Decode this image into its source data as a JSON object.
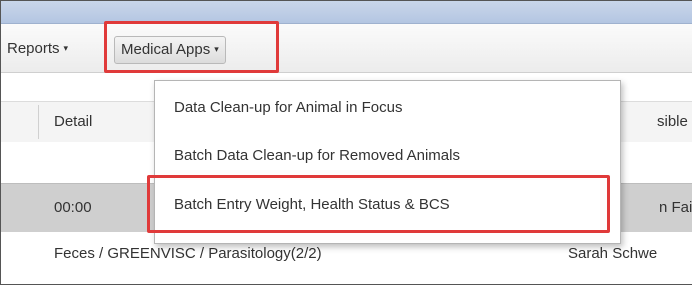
{
  "menubar": {
    "reports_label": "Reports",
    "medical_apps_label": "Medical Apps",
    "caret": "▾"
  },
  "grid": {
    "header_detail": "Detail",
    "header_responsible": "sible",
    "rows": [
      {
        "detail": "00:00",
        "responsible": "n Fai"
      },
      {
        "detail": "Feces / GREENVISC / Parasitology(2/2)",
        "responsible": "Sarah Schwe"
      }
    ]
  },
  "dropdown": {
    "items": [
      {
        "label": "Data Clean-up for Animal in Focus"
      },
      {
        "label": "Batch Data Clean-up for Removed Animals"
      },
      {
        "label": "Batch Entry Weight, Health Status & BCS"
      }
    ]
  },
  "colors": {
    "highlight": "#e03a3a",
    "selected_row": "#cfcfcf",
    "top_bar": "#b4c6e2"
  }
}
